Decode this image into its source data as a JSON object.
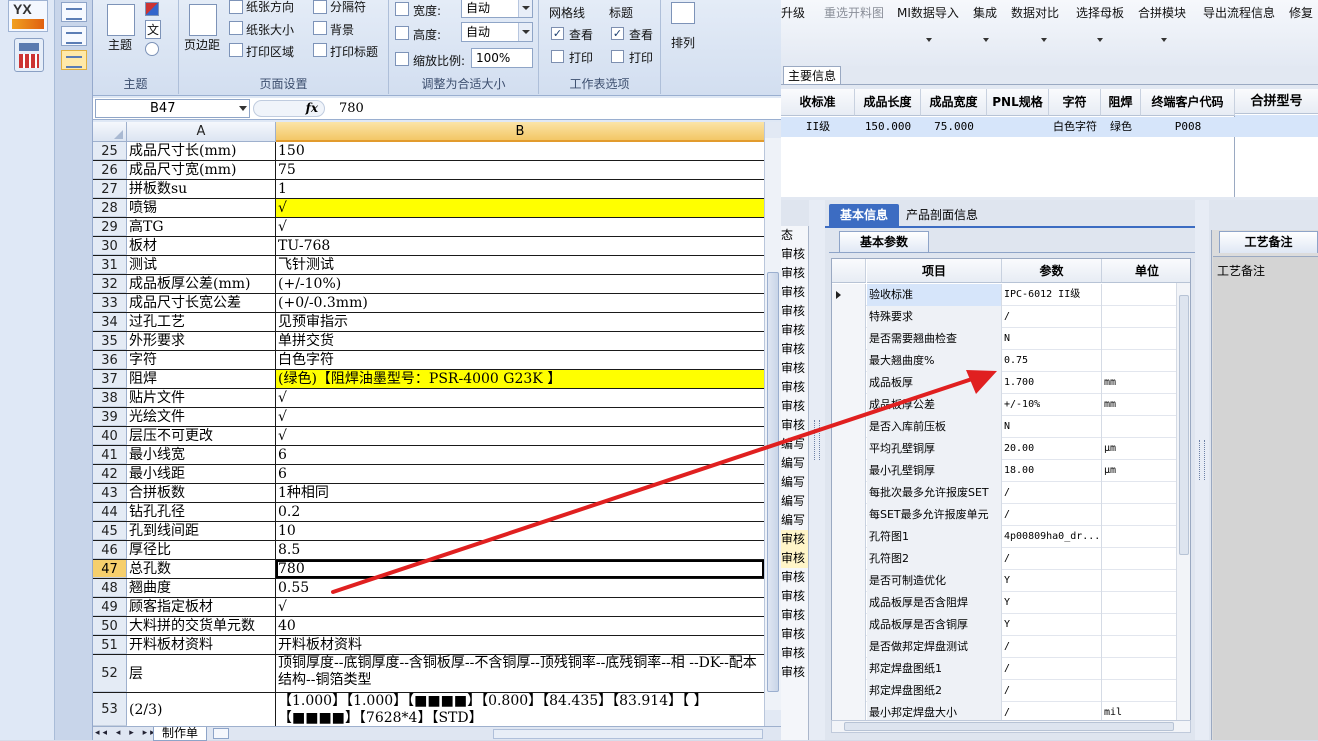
{
  "left_strip": {
    "logo_text": "YX"
  },
  "ribbon": {
    "theme_group": {
      "label": "主题",
      "theme_btn": "主题",
      "colors_icon": "theme-colors-icon",
      "fonts_btn": "文",
      "effects_icon": "theme-effects-icon"
    },
    "page_setup_group": {
      "label": "页面设置",
      "margins": "页边距",
      "orientation": "纸张方向",
      "size": "纸张大小",
      "print_area": "打印区域",
      "breaks": "分隔符",
      "background": "背景",
      "print_titles": "打印标题"
    },
    "scale_group": {
      "label": "调整为合适大小",
      "width_label": "宽度:",
      "width_value": "自动",
      "height_label": "高度:",
      "height_value": "自动",
      "scale_label": "缩放比例:",
      "scale_value": "100%"
    },
    "sheet_options_group": {
      "label": "工作表选项",
      "gridlines": "网格线",
      "headings": "标题",
      "view": "查看",
      "print": "打印",
      "view2": "查看",
      "print2": "打印"
    },
    "arrange": "排列"
  },
  "formula_bar": {
    "name_box": "B47",
    "fx": "fx",
    "value": "780"
  },
  "sheet": {
    "col_a": "A",
    "col_b": "B",
    "rows": [
      {
        "n": "25",
        "a": "成品尺寸长(mm)",
        "b": "150"
      },
      {
        "n": "26",
        "a": "成品尺寸宽(mm)",
        "b": "75"
      },
      {
        "n": "27",
        "a": "拼板数su",
        "b": "1"
      },
      {
        "n": "28",
        "a": "喷锡",
        "b": "√"
      },
      {
        "n": "29",
        "a": "高TG",
        "b": "√"
      },
      {
        "n": "30",
        "a": "板材",
        "b": "TU-768"
      },
      {
        "n": "31",
        "a": "测试",
        "b": "飞针测试"
      },
      {
        "n": "32",
        "a": "成品板厚公差(mm)",
        "b": "(+/-10%)"
      },
      {
        "n": "33",
        "a": "成品尺寸长宽公差",
        "b": "(+0/-0.3mm)"
      },
      {
        "n": "34",
        "a": "过孔工艺",
        "b": "见预审指示"
      },
      {
        "n": "35",
        "a": "外形要求",
        "b": "单拼交货"
      },
      {
        "n": "36",
        "a": "字符",
        "b": "白色字符"
      },
      {
        "n": "37",
        "a": "阻焊",
        "b": "(绿色)【阻焊油墨型号：PSR-4000 G23K 】"
      },
      {
        "n": "38",
        "a": "贴片文件",
        "b": "√"
      },
      {
        "n": "39",
        "a": "光绘文件",
        "b": "√"
      },
      {
        "n": "40",
        "a": "层压不可更改",
        "b": "√"
      },
      {
        "n": "41",
        "a": "最小线宽",
        "b": "6"
      },
      {
        "n": "42",
        "a": "最小线距",
        "b": "6"
      },
      {
        "n": "43",
        "a": "合拼板数",
        "b": "1种相同"
      },
      {
        "n": "44",
        "a": "钻孔孔径",
        "b": "0.2"
      },
      {
        "n": "45",
        "a": "孔到线间距",
        "b": "10"
      },
      {
        "n": "46",
        "a": "厚径比",
        "b": "8.5"
      },
      {
        "n": "47",
        "a": "总孔数",
        "b": "780"
      },
      {
        "n": "48",
        "a": "翘曲度",
        "b": "0.55"
      },
      {
        "n": "49",
        "a": "顾客指定板材",
        "b": "√"
      },
      {
        "n": "50",
        "a": "大料拼的交货单元数",
        "b": "40"
      },
      {
        "n": "51",
        "a": "开料板材资料",
        "b": "开料板材资料"
      },
      {
        "n": "52",
        "a": "层",
        "b": "顶铜厚度--底铜厚度--含铜板厚--不含铜厚--顶残铜率--底残铜率--相 --DK--配本结构--铜箔类型"
      },
      {
        "n": "53",
        "a": "(2/3)",
        "b": "【1.000】【1.000】【■■■■】【0.800】【84.435】【83.914】【 】【■■■■】【7628*4】【STD】"
      }
    ],
    "tab_nav": "◂◂ ◂ ▸ ▸▸",
    "sheet_tab": "制作单"
  },
  "app": {
    "menu": [
      {
        "label": "升级",
        "disabled": false
      },
      {
        "label": "重选开料图",
        "disabled": true
      },
      {
        "label": "MI数据导入",
        "disabled": false
      },
      {
        "label": "集成",
        "disabled": false
      },
      {
        "label": "数据对比",
        "disabled": false
      },
      {
        "label": "选择母板",
        "disabled": false
      },
      {
        "label": "合拼模块",
        "disabled": false
      },
      {
        "label": "导出流程信息",
        "disabled": false
      },
      {
        "label": "修复",
        "disabled": false
      }
    ],
    "main_tab": "主要信息",
    "main_grid": {
      "headers": [
        "收标准",
        "成品长度",
        "成品宽度",
        "PNL规格",
        "字符",
        "阻焊",
        "终端客户代码"
      ],
      "row": [
        "II级",
        "150.000",
        "75.000",
        "",
        "白色字符",
        "绿色",
        "P008"
      ],
      "right_header": "合拼型号"
    },
    "status_col": [
      "态",
      "审核",
      "审核",
      "审核",
      "审核",
      "审核",
      "审核",
      "审核",
      "审核",
      "审核",
      "审核",
      "编写",
      "编写",
      "编写",
      "编写",
      "编写",
      "审核",
      "审核",
      "审核",
      "审核",
      "审核",
      "审核",
      "审核",
      "审核"
    ],
    "tabs": {
      "basic": "基本信息",
      "profile": "产品剖面信息",
      "basic_params": "基本参数",
      "process_notes_tab": "工艺备注",
      "process_notes_label": "工艺备注"
    },
    "param_headers": [
      "项目",
      "参数",
      "单位"
    ],
    "params": [
      {
        "k": "验收标准",
        "v": "IPC-6012 II级",
        "u": ""
      },
      {
        "k": "特殊要求",
        "v": "/",
        "u": ""
      },
      {
        "k": "是否需要翘曲检查",
        "v": "N",
        "u": ""
      },
      {
        "k": "最大翘曲度%",
        "v": "0.75",
        "u": ""
      },
      {
        "k": "成品板厚",
        "v": "1.700",
        "u": "mm"
      },
      {
        "k": "成品板厚公差",
        "v": "+/-10%",
        "u": "mm"
      },
      {
        "k": "是否入库前压板",
        "v": "N",
        "u": ""
      },
      {
        "k": "平均孔壁铜厚",
        "v": "20.00",
        "u": "μm"
      },
      {
        "k": "最小孔壁铜厚",
        "v": "18.00",
        "u": "μm"
      },
      {
        "k": "每批次最多允许报废SET",
        "v": "/",
        "u": ""
      },
      {
        "k": "每SET最多允许报废单元",
        "v": "/",
        "u": ""
      },
      {
        "k": "孔符图1",
        "v": "4p00809ha0_dr...",
        "u": ""
      },
      {
        "k": "孔符图2",
        "v": "/",
        "u": ""
      },
      {
        "k": "是否可制造优化",
        "v": "Y",
        "u": ""
      },
      {
        "k": "成品板厚是否含阻焊",
        "v": "Y",
        "u": ""
      },
      {
        "k": "成品板厚是否含铜厚",
        "v": "Y",
        "u": ""
      },
      {
        "k": "是否做邦定焊盘测试",
        "v": "/",
        "u": ""
      },
      {
        "k": "邦定焊盘图纸1",
        "v": "/",
        "u": ""
      },
      {
        "k": "邦定焊盘图纸2",
        "v": "/",
        "u": ""
      },
      {
        "k": "最小邦定焊盘大小",
        "v": "/",
        "u": "mil"
      }
    ]
  },
  "annotation": {
    "arrow_color": "#e02020"
  }
}
